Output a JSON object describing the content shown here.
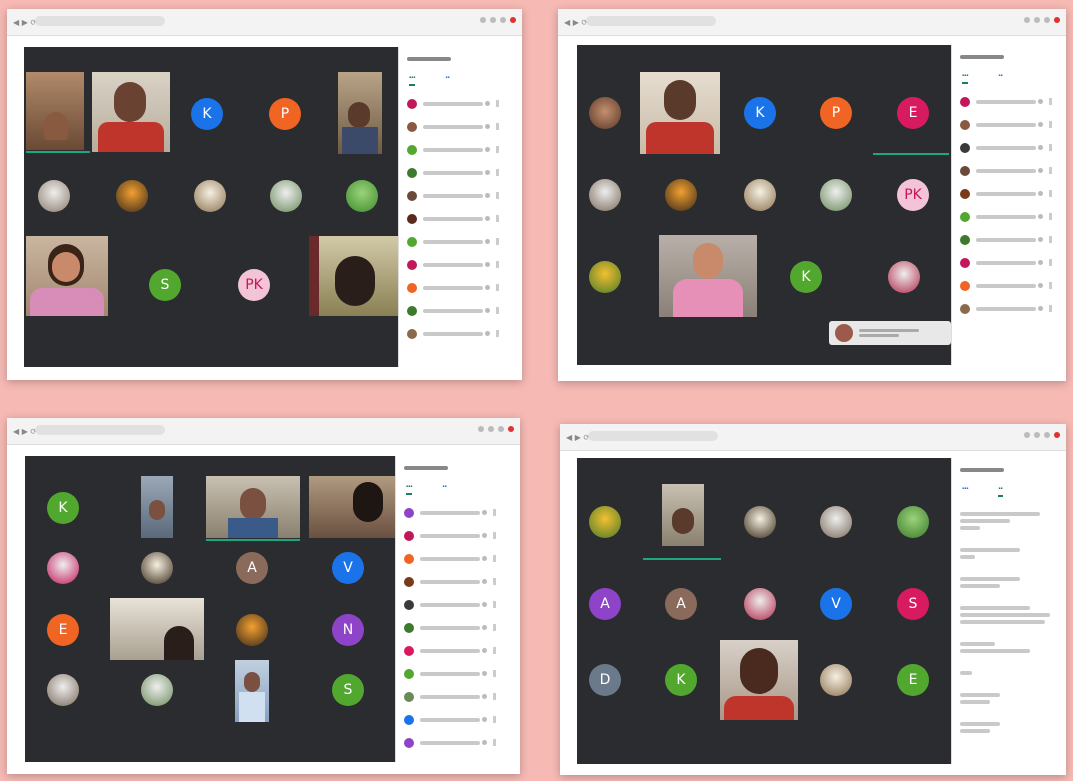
{
  "colors": {
    "background": "#f6b9b4",
    "stage": "#2b2c2f",
    "speaking": "#1ea77c"
  },
  "shots": [
    {
      "name": "top-left-meeting",
      "avatars": [
        "K",
        "P",
        "S",
        "PK"
      ],
      "tab": "People"
    },
    {
      "name": "top-right-meeting",
      "avatars": [
        "K",
        "P",
        "E",
        "PK",
        "K"
      ],
      "tab": "People"
    },
    {
      "name": "bottom-left-meeting",
      "avatars": [
        "K",
        "A",
        "V",
        "E",
        "N",
        "S"
      ],
      "tab": "People"
    },
    {
      "name": "bottom-right-meeting",
      "avatars": [
        "A",
        "A",
        "V",
        "S",
        "K",
        "D",
        "E"
      ],
      "tab": "Chat"
    }
  ],
  "avatar_labels": {
    "k": "K",
    "p": "P",
    "s": "S",
    "pk": "PK",
    "e": "E",
    "a": "A",
    "v": "V",
    "n": "N",
    "d": "D"
  }
}
